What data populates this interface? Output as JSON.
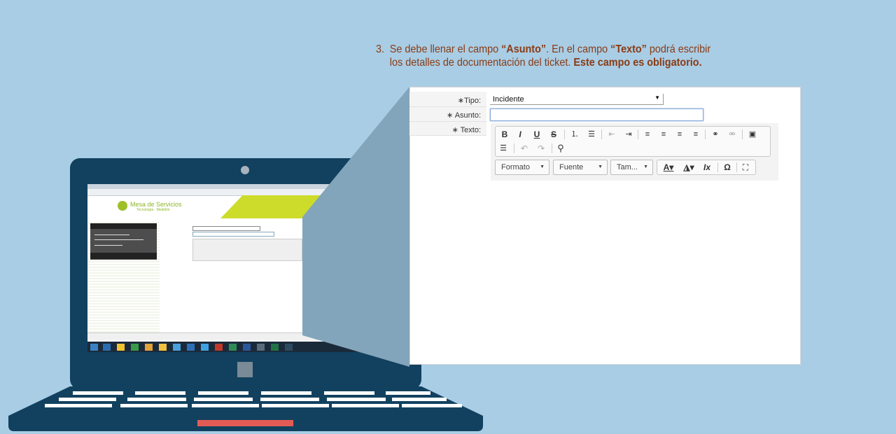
{
  "instruction": {
    "number": "3.",
    "p1": "Se debe llenar el campo ",
    "b1": "“Asunto”",
    "p2": ". En el campo ",
    "b2": "“Texto”",
    "p3": " podrá escribir",
    "p4": "los detalles de documentación del ticket. ",
    "b3": "Este campo es obligatorio."
  },
  "form": {
    "tipo_label": "∗Tipo:",
    "tipo_value": "Incidente",
    "asunto_label": "∗ Asunto:",
    "texto_label": "∗ Texto:"
  },
  "editor": {
    "format_label": "Formato",
    "font_label": "Fuente",
    "size_label": "Tam..."
  },
  "mini": {
    "logo_title": "Mesa de Servicios",
    "logo_sub": "Tecnología · Medellín"
  },
  "colors": {
    "background": "#a9cde5",
    "laptop": "#12415f",
    "accent_text": "#8a3b14",
    "banner_green": "#cddc2a",
    "trackpad": "#e35b55"
  }
}
